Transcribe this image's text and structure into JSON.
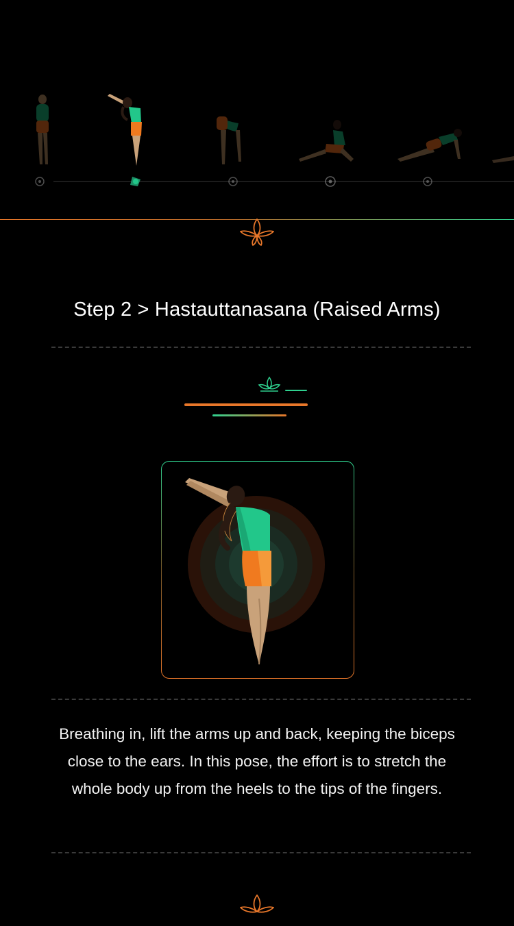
{
  "carousel": {
    "steps": [
      {
        "step": 1,
        "state": "inactive"
      },
      {
        "step": 2,
        "state": "active"
      },
      {
        "step": 3,
        "state": "inactive"
      },
      {
        "step": 4,
        "state": "inactive"
      },
      {
        "step": 5,
        "state": "inactive"
      },
      {
        "step": 6,
        "state": "inactive"
      }
    ]
  },
  "title": "Step 2 > Hastauttanasana (Raised Arms)",
  "description": "Breathing in, lift the arms up and back, keeping the biceps close to the ears. In this pose, the effort is to stretch the whole body up from the heels to the tips of the fingers.",
  "colors": {
    "accent_orange": "#e8772a",
    "accent_green": "#2fd18f",
    "skin": "#c9a27a",
    "shorts": "#f07a1f",
    "top": "#22c78a",
    "background": "#000000"
  },
  "icons": {
    "divider": "lotus-icon",
    "header": "lotus-icon",
    "carousel_marker": "flower-marker-icon"
  }
}
